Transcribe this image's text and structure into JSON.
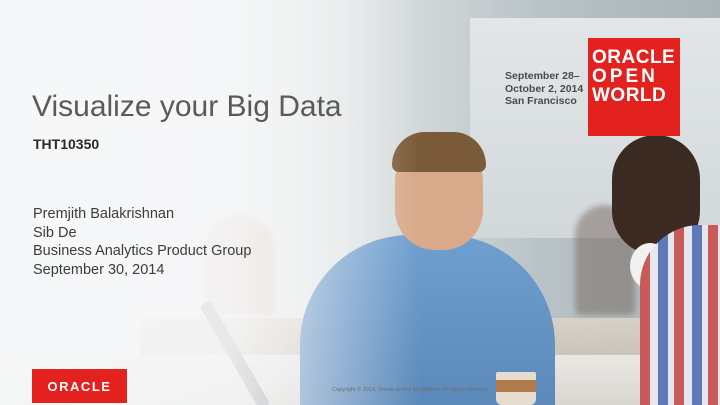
{
  "slide": {
    "title": "Visualize your Big Data",
    "session_code": "THT10350",
    "presenters": [
      "Premjith Balakrishnan",
      "Sib De",
      "Business Analytics Product Group",
      "September 30, 2014"
    ]
  },
  "event": {
    "dates": [
      "September 28–",
      "October 2, 2014",
      "San Francisco"
    ],
    "logo_lines": [
      "ORACLE",
      "OPEN",
      "WORLD"
    ]
  },
  "footer": {
    "brand": "ORACLE",
    "copyright": "Copyright © 2014, Oracle and/or its affiliates. All rights reserved."
  },
  "colors": {
    "brand_red": "#e3211e",
    "title_gray": "#5a5a5a"
  }
}
